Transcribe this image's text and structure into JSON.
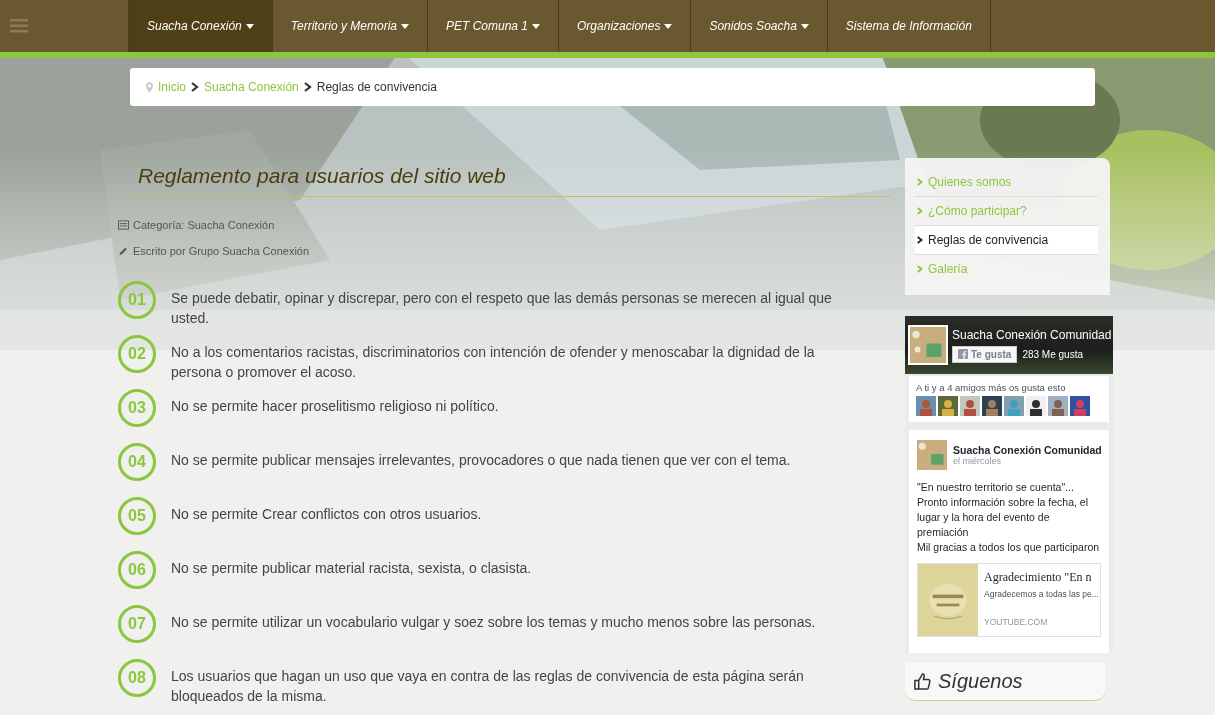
{
  "nav": {
    "items": [
      {
        "label": "Suacha Conexión",
        "has_dropdown": true,
        "selected": true
      },
      {
        "label": "Territorio y Memoria",
        "has_dropdown": true,
        "selected": false
      },
      {
        "label": "PET Comuna 1",
        "has_dropdown": true,
        "selected": false
      },
      {
        "label": "Organizaciones",
        "has_dropdown": true,
        "selected": false
      },
      {
        "label": "Sonidos Soacha",
        "has_dropdown": true,
        "selected": false
      },
      {
        "label": "Sistema de Información",
        "has_dropdown": false,
        "selected": false
      }
    ]
  },
  "breadcrumb": [
    {
      "label": "Inicio",
      "kind": "home"
    },
    {
      "label": "Suacha Conexión",
      "kind": "link"
    },
    {
      "label": "Reglas de convivencia",
      "kind": "current"
    }
  ],
  "article": {
    "title": "Reglamento para usuarios del sitio web",
    "category": "Categoría: Suacha Conexión",
    "author": "Escrito por Grupo Suacha Conexión",
    "rules": [
      {
        "number": "01",
        "text": "Se puede debatir, opinar y discrepar, pero con el respeto que las demás personas se merecen al igual que usted."
      },
      {
        "number": "02",
        "text": "No a los comentarios racistas, discriminatorios con intención de ofender y menoscabar la dignidad de la persona o promover el acoso."
      },
      {
        "number": "03",
        "text": "No se permite hacer proselitismo religioso ni político."
      },
      {
        "number": "04",
        "text": "No se permite publicar mensajes irrelevantes, provocadores o que nada tienen que ver con el tema."
      },
      {
        "number": "05",
        "text": "No se permite Crear conflictos con otros usuarios."
      },
      {
        "number": "06",
        "text": "No se permite publicar material racista, sexista, o clasista."
      },
      {
        "number": "07",
        "text": "No se permite utilizar un vocabulario vulgar y soez sobre los temas y mucho menos sobre las personas."
      },
      {
        "number": "08",
        "text": "Los usuarios que hagan un uso que vaya en contra de las reglas de convivencia de esta página serán bloqueados de la misma."
      }
    ]
  },
  "sidebar": {
    "menu": [
      {
        "label": "Quienes somos",
        "selected": false
      },
      {
        "label": "¿Cómo participar?",
        "selected": false
      },
      {
        "label": "Reglas de convivencia",
        "selected": true
      },
      {
        "label": "Galería",
        "selected": false
      }
    ],
    "facebook": {
      "page_name": "Suacha Conexión Comunidad",
      "like_button": "Te gusta",
      "likes": "283 Me gusta",
      "friends_text": "A ti y a 4 amigos más os gusta esto",
      "post": {
        "author": "Suacha Conexión Comunidad",
        "time": "el miércoles",
        "paragraphs": [
          "\"En nuestro territorio se cuenta\"... Pronto información sobre la fecha, el lugar y la hora del evento de premiación",
          "Mil gracias a todos los que participaron"
        ],
        "link_card": {
          "title": "Agradecimiento \"En n",
          "description": "Agradecemos a todas las pe...",
          "domain": "YOUTUBE.COM"
        }
      }
    },
    "follow_heading": "Síguenos"
  }
}
